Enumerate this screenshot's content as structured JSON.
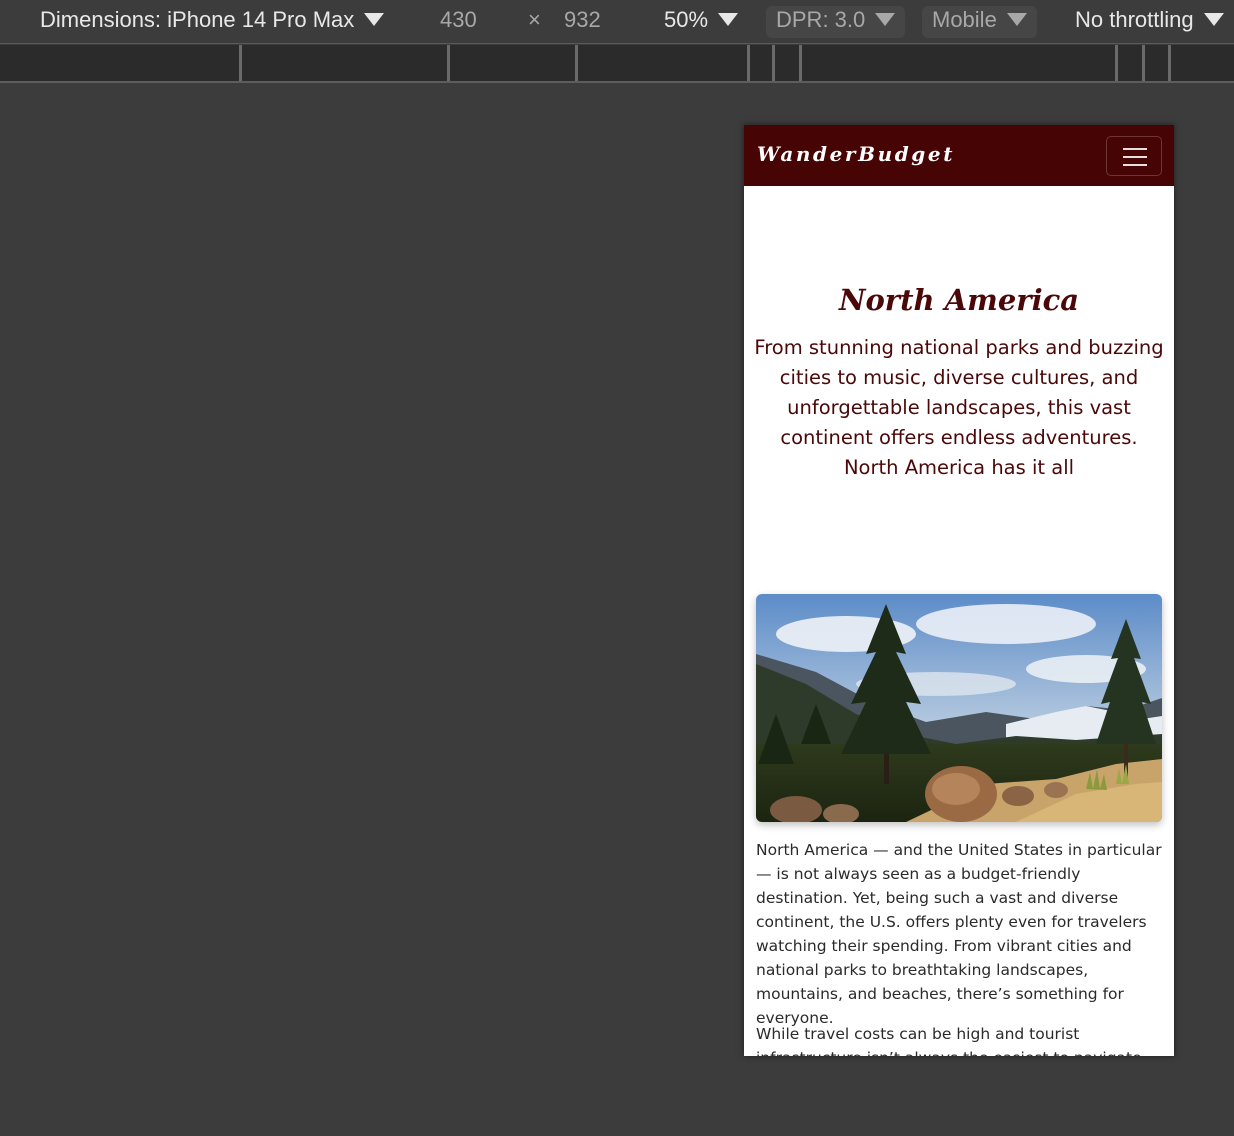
{
  "devtools": {
    "device_label": "Dimensions: iPhone 14 Pro Max",
    "width": "430",
    "times": "×",
    "height": "932",
    "zoom": "50%",
    "dpr": "DPR: 3.0",
    "mode": "Mobile",
    "throttling": "No throttling"
  },
  "site": {
    "brand": "WanderBudget",
    "nav_toggle_label": "Toggle navigation",
    "hero": {
      "title": "North America",
      "subtitle": "From stunning national parks and buzzing cities to music, diverse cultures, and unforgettable landscapes, this vast continent offers endless adventures. North America has it all"
    },
    "image_alt": "Mountain landscape with pine trees and boulders",
    "paragraphs": [
      "North America — and the United States in particular — is not always seen as a budget-friendly destination. Yet, being such a vast and diverse continent, the U.S. offers plenty even for travelers watching their spending. From vibrant cities and national parks to breathtaking landscapes, mountains, and beaches, there’s something for everyone.",
      "While travel costs can be high and tourist infrastructure isn’t always the easiest to navigate, the"
    ]
  },
  "colors": {
    "navbar": "#470404",
    "heading": "#4a0808",
    "devtools_bg": "#3c3c3c"
  }
}
